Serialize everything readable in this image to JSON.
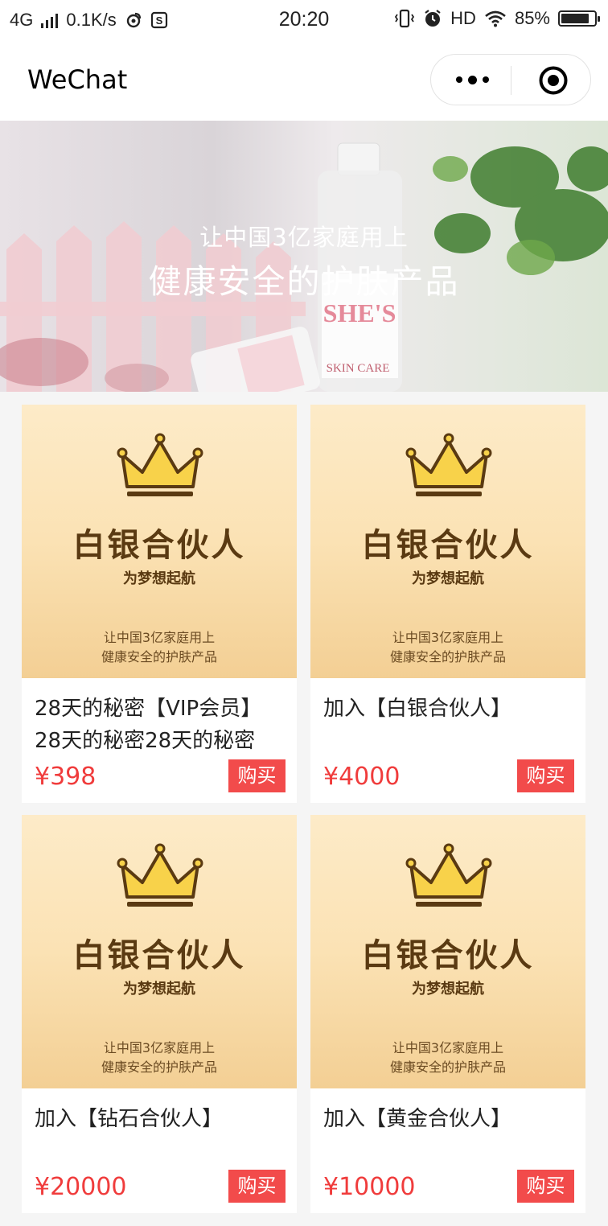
{
  "status_bar": {
    "network": "4G",
    "speed": "0.1K/s",
    "time": "20:20",
    "hd": "HD",
    "battery": "85%",
    "battery_level": 0.85
  },
  "navbar": {
    "title": "WeChat"
  },
  "banner": {
    "line1": "让中国3亿家庭用上",
    "line2": "健康安全的护肤产品",
    "product_label_brand": "SHE'S",
    "product_label_text": "SKIN CARE"
  },
  "products": [
    {
      "image_title": "白银合伙人",
      "image_subtitle": "为梦想起航",
      "image_foot1": "让中国3亿家庭用上",
      "image_foot2": "健康安全的护肤产品",
      "name": "28天的秘密【VIP会员】28天的秘密28天的秘密",
      "price": "¥398",
      "buy_label": "购买"
    },
    {
      "image_title": "白银合伙人",
      "image_subtitle": "为梦想起航",
      "image_foot1": "让中国3亿家庭用上",
      "image_foot2": "健康安全的护肤产品",
      "name": "加入【白银合伙人】",
      "price": "¥4000",
      "buy_label": "购买"
    },
    {
      "image_title": "白银合伙人",
      "image_subtitle": "为梦想起航",
      "image_foot1": "让中国3亿家庭用上",
      "image_foot2": "健康安全的护肤产品",
      "name": "加入【钻石合伙人】",
      "price": "¥20000",
      "buy_label": "购买"
    },
    {
      "image_title": "白银合伙人",
      "image_subtitle": "为梦想起航",
      "image_foot1": "让中国3亿家庭用上",
      "image_foot2": "健康安全的护肤产品",
      "name": "加入【黄金合伙人】",
      "price": "¥10000",
      "buy_label": "购买"
    }
  ],
  "colors": {
    "price": "#f03c3c",
    "buy_button": "#f24b4b",
    "card_image_top": "#fdebc8",
    "card_image_bottom": "#f3cf94",
    "crown": "#f8d24a",
    "crown_outline": "#5a3a12"
  },
  "icons": {
    "signal": "signal-bars-icon",
    "weibo": "weibo-icon",
    "app": "s-app-icon",
    "vibrate": "vibrate-icon",
    "alarm": "alarm-icon",
    "wifi": "wifi-icon",
    "battery": "battery-icon",
    "more": "more-dots-icon",
    "close": "close-target-icon",
    "crown": "crown-icon"
  }
}
